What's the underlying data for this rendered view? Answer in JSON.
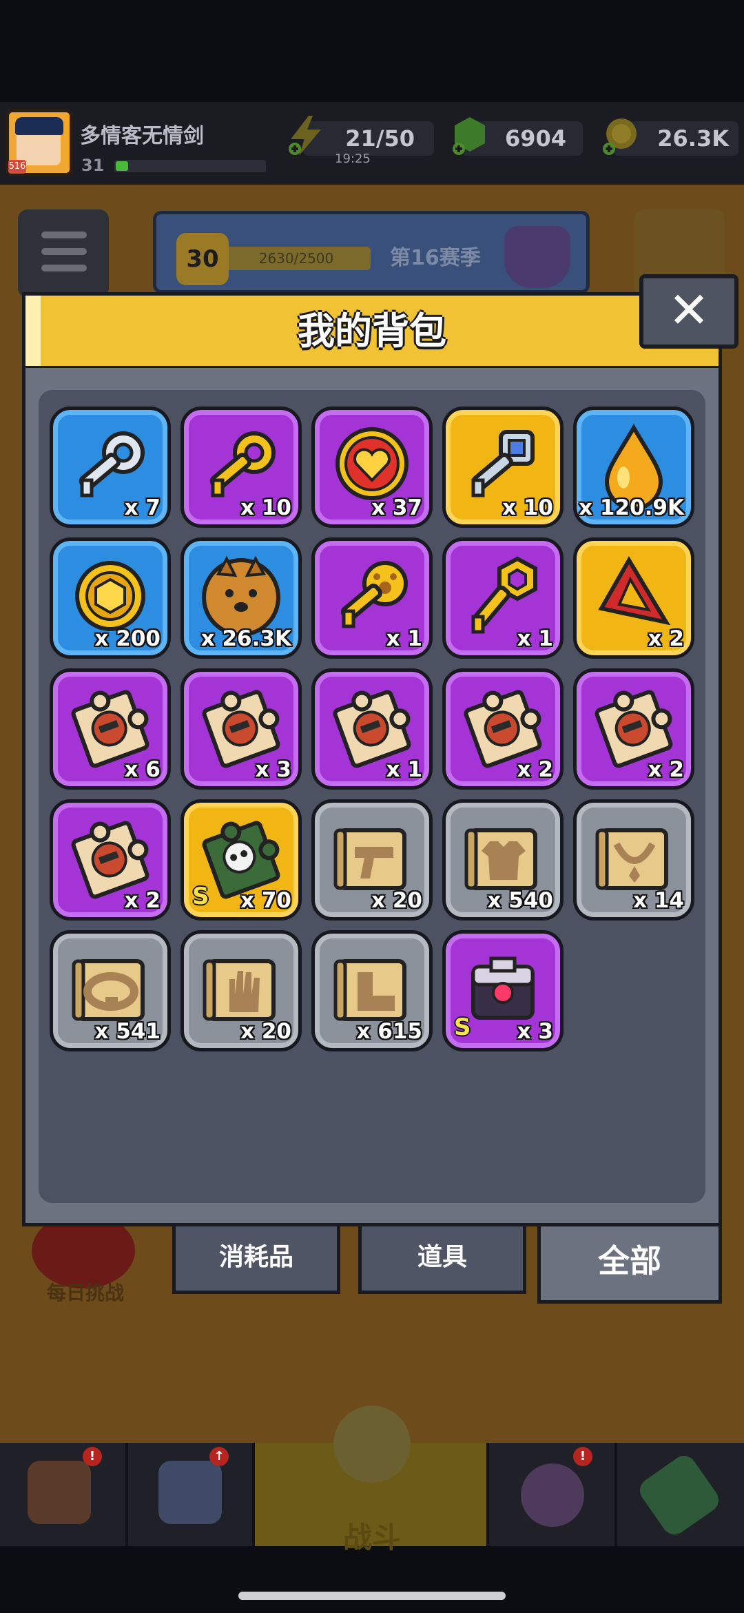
{
  "player": {
    "name": "多情客无情剑",
    "level": "31",
    "avatar_level": "516"
  },
  "resources": {
    "energy": "21/50",
    "energy_timer": "19:25",
    "gems": "6904",
    "coins": "26.3K"
  },
  "season": {
    "rank": "30",
    "progress": "2630/2500",
    "name": "第16赛季"
  },
  "background": {
    "daily_challenge": "每日挑战",
    "fight": "战斗"
  },
  "modal": {
    "title": "我的背包",
    "close": "✕"
  },
  "items": [
    {
      "qty": "x 7",
      "rarity": "blue",
      "icon": "silver-key-icon"
    },
    {
      "qty": "x 10",
      "rarity": "purple",
      "icon": "gold-key-icon"
    },
    {
      "qty": "x 37",
      "rarity": "purple",
      "icon": "heart-coin-icon"
    },
    {
      "qty": "x 10",
      "rarity": "gold",
      "icon": "gem-key-icon"
    },
    {
      "qty": "x 120.9K",
      "rarity": "blue",
      "icon": "gold-drop-icon"
    },
    {
      "qty": "x 200",
      "rarity": "blue",
      "icon": "gold-coin-icon"
    },
    {
      "qty": "x 26.3K",
      "rarity": "blue",
      "icon": "dog-cookie-icon"
    },
    {
      "qty": "x 1",
      "rarity": "purple",
      "icon": "paw-key-icon"
    },
    {
      "qty": "x 1",
      "rarity": "purple",
      "icon": "hex-key-icon"
    },
    {
      "qty": "x 2",
      "rarity": "gold",
      "icon": "red-triangle-icon"
    },
    {
      "qty": "x 6",
      "rarity": "purple",
      "icon": "hero-puzzle-icon"
    },
    {
      "qty": "x 3",
      "rarity": "purple",
      "icon": "hero-puzzle-icon"
    },
    {
      "qty": "x 1",
      "rarity": "purple",
      "icon": "hero-puzzle-icon"
    },
    {
      "qty": "x 2",
      "rarity": "purple",
      "icon": "hero-puzzle-icon"
    },
    {
      "qty": "x 2",
      "rarity": "purple",
      "icon": "hero-puzzle-icon"
    },
    {
      "qty": "x 2",
      "rarity": "purple",
      "icon": "hero-puzzle-icon"
    },
    {
      "qty": "x 70",
      "rarity": "gold",
      "icon": "skull-puzzle-icon",
      "s": "S"
    },
    {
      "qty": "x 20",
      "rarity": "gray",
      "icon": "gun-scroll-icon"
    },
    {
      "qty": "x 540",
      "rarity": "gray",
      "icon": "armor-scroll-icon"
    },
    {
      "qty": "x 14",
      "rarity": "gray",
      "icon": "necklace-scroll-icon"
    },
    {
      "qty": "x 541",
      "rarity": "gray",
      "icon": "belt-scroll-icon"
    },
    {
      "qty": "x 20",
      "rarity": "gray",
      "icon": "glove-scroll-icon"
    },
    {
      "qty": "x 615",
      "rarity": "gray",
      "icon": "boots-scroll-icon"
    },
    {
      "qty": "x 3",
      "rarity": "purple",
      "icon": "chest-icon",
      "s": "S"
    }
  ],
  "tabs": [
    {
      "label": "消耗品"
    },
    {
      "label": "道具"
    },
    {
      "label": "全部",
      "active": true
    }
  ]
}
